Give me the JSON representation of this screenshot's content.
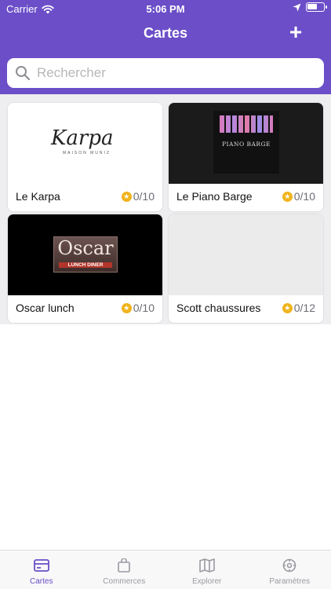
{
  "status_bar": {
    "carrier": "Carrier",
    "time": "5:06 PM"
  },
  "header": {
    "title": "Cartes",
    "add_label": "+"
  },
  "search": {
    "placeholder": "Rechercher"
  },
  "cards": [
    {
      "name": "Le Karpa",
      "score": "0/10",
      "image_label": "Karpa",
      "image_sublabel": "MAISON MUNIZ"
    },
    {
      "name": "Le Piano Barge",
      "score": "0/10",
      "image_label": "PIANO BARGE"
    },
    {
      "name": "Oscar lunch",
      "score": "0/10",
      "image_label": "Oscar",
      "image_sublabel": "LUNCH DINER"
    },
    {
      "name": "Scott chaussures",
      "score": "0/12"
    }
  ],
  "tabs": [
    {
      "label": "Cartes",
      "icon": "card-icon",
      "active": true
    },
    {
      "label": "Commerces",
      "icon": "shopping-bag-icon"
    },
    {
      "label": "Explorer",
      "icon": "map-icon"
    },
    {
      "label": "Paramètres",
      "icon": "gear-icon"
    }
  ],
  "colors": {
    "primary": "#6b4ec8",
    "star": "#f0b41c",
    "background": "#eeeef0"
  }
}
